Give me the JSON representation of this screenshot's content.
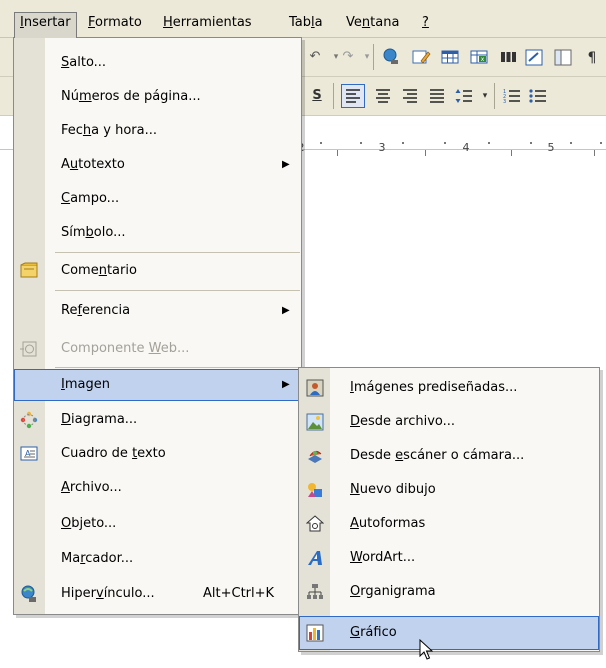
{
  "menubar": {
    "items": [
      {
        "pre": "",
        "u": "I",
        "post": "nsertar",
        "active": true
      },
      {
        "pre": "",
        "u": "F",
        "post": "ormato"
      },
      {
        "pre": "",
        "u": "H",
        "post": "erramientas"
      },
      {
        "pre": "Tab",
        "u": "l",
        "post": "a"
      },
      {
        "pre": "Ve",
        "u": "n",
        "post": "tana"
      },
      {
        "pre": "",
        "u": "?",
        "post": ""
      }
    ]
  },
  "toolbar": {
    "undo_icon": "undo-icon",
    "redo_icon": "redo-icon",
    "underline_label": "S"
  },
  "ruler": {
    "labels": [
      "2",
      "3",
      "4",
      "5"
    ]
  },
  "insert_menu": {
    "items": [
      {
        "pre": "",
        "u": "S",
        "post": "alto...",
        "icon": null
      },
      {
        "pre": "Nú",
        "u": "m",
        "post": "eros de página...",
        "icon": null
      },
      {
        "pre": "Fec",
        "u": "h",
        "post": "a y hora...",
        "icon": null
      },
      {
        "pre": "A",
        "u": "u",
        "post": "totexto",
        "submenu": true,
        "icon": null
      },
      {
        "pre": "",
        "u": "C",
        "post": "ampo...",
        "icon": null
      },
      {
        "pre": "Sím",
        "u": "b",
        "post": "olo...",
        "icon": null
      },
      {
        "pre": "Come",
        "u": "n",
        "post": "tario",
        "icon": "comment-icon"
      },
      {
        "pre": "Re",
        "u": "f",
        "post": "erencia",
        "submenu": true,
        "icon": null
      },
      {
        "pre": "Componente ",
        "u": "W",
        "post": "eb...",
        "disabled": true,
        "icon": "web-component-icon"
      },
      {
        "pre": "",
        "u": "I",
        "post": "magen",
        "submenu": true,
        "highlighted": true,
        "icon": null
      },
      {
        "pre": "",
        "u": "D",
        "post": "iagrama...",
        "icon": "diagram-icon"
      },
      {
        "pre": "Cuadro de ",
        "u": "t",
        "post": "exto",
        "icon": "textbox-icon"
      },
      {
        "pre": "",
        "u": "A",
        "post": "rchivo...",
        "icon": null
      },
      {
        "pre": "",
        "u": "O",
        "post": "bjeto...",
        "icon": null
      },
      {
        "pre": "Ma",
        "u": "r",
        "post": "cador...",
        "icon": null
      },
      {
        "pre": "Hiper",
        "u": "v",
        "post": "ínculo...",
        "shortcut": "Alt+Ctrl+K",
        "icon": "hyperlink-icon"
      }
    ]
  },
  "image_submenu": {
    "items": [
      {
        "pre": "",
        "u": "I",
        "post": "mágenes prediseñadas...",
        "icon": "clipart-icon"
      },
      {
        "pre": "",
        "u": "D",
        "post": "esde archivo...",
        "icon": "picture-file-icon"
      },
      {
        "pre": "Desde ",
        "u": "e",
        "post": "scáner o cámara...",
        "icon": "scanner-camera-icon"
      },
      {
        "pre": "",
        "u": "N",
        "post": "uevo dibujo",
        "icon": "new-drawing-icon"
      },
      {
        "pre": "",
        "u": "A",
        "post": "utoformas",
        "icon": "autoshapes-icon"
      },
      {
        "pre": "",
        "u": "W",
        "post": "ordArt...",
        "icon": "wordart-icon"
      },
      {
        "pre": "",
        "u": "O",
        "post": "rganigrama",
        "icon": "org-chart-icon"
      },
      {
        "pre": "",
        "u": "G",
        "post": "ráfico",
        "icon": "chart-icon",
        "highlighted": true
      }
    ]
  },
  "colors": {
    "menu_bg": "#f9f8f4",
    "gutter": "#e4e2d6",
    "highlight": "#c1d2ee",
    "highlight_border": "#316ac5",
    "chrome": "#ece9d8"
  }
}
